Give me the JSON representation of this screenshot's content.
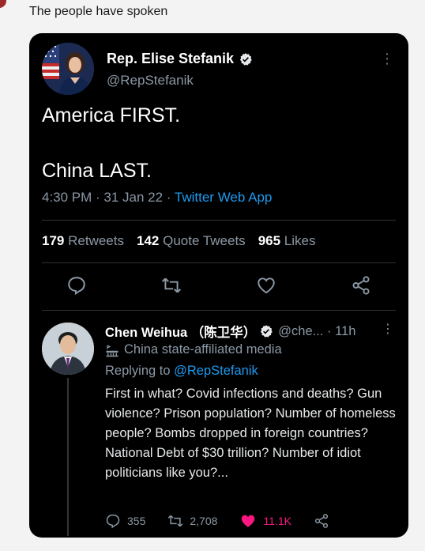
{
  "caption": "The people have spoken",
  "tweet": {
    "display_name": "Rep. Elise Stefanik",
    "handle": "@RepStefanik",
    "line1": "America FIRST.",
    "line2": "China LAST.",
    "time": "4:30 PM · 31 Jan 22 · ",
    "app": "Twitter Web App",
    "stats": {
      "retweets_count": "179",
      "retweets_label": "Retweets",
      "quotes_count": "142",
      "quotes_label": "Quote Tweets",
      "likes_count": "965",
      "likes_label": "Likes"
    },
    "more_glyph": "⋮"
  },
  "reply": {
    "display_name": "Chen Weihua （陈卫华）",
    "handle_time": "@che... · 11h",
    "more_glyph": "⋮",
    "affiliation": "China state-affiliated media",
    "replying_prefix": "Replying to ",
    "replying_mention": "@RepStefanik",
    "body": "First in what? Covid infections and deaths? Gun violence? Prison population? Number of homeless people? Bombs dropped in foreign countries? National Debt of $30 trillion? Number of idiot politicians like you?...",
    "replies": "355",
    "retweets": "2,708",
    "likes": "11.1K"
  },
  "colors": {
    "accent": "#1d9bf0",
    "like": "#f91880",
    "card": "#000000",
    "muted": "#8b98a5"
  },
  "icons": [
    "verified-badge-icon",
    "reply-icon",
    "retweet-icon",
    "like-icon",
    "share-icon",
    "more-icon",
    "government-building-icon"
  ]
}
